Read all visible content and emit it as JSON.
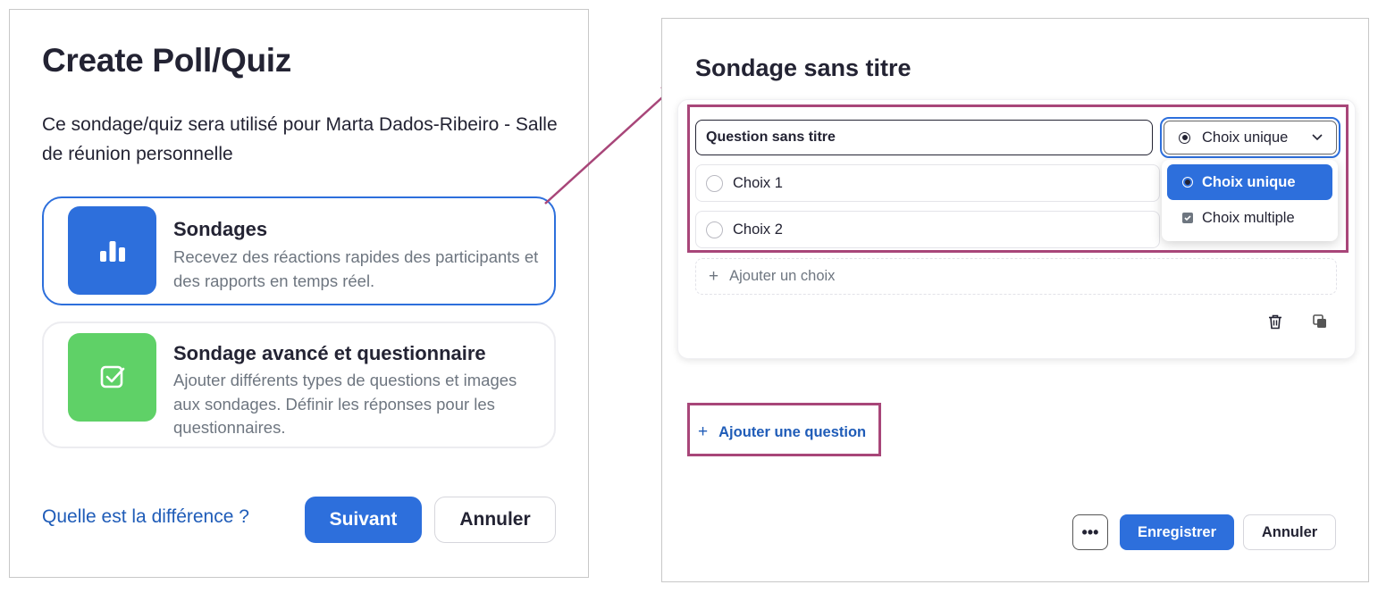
{
  "left": {
    "title": "Create Poll/Quiz",
    "description": "Ce sondage/quiz sera utilisé pour Marta Dados-Ribeiro - Salle de réunion personnelle",
    "options": [
      {
        "name": "Sondages",
        "text": "Recevez des réactions rapides des participants et des rapports en temps réel.",
        "icon": "bar-chart-icon",
        "color": "#2d6fdc",
        "selected": true
      },
      {
        "name": "Sondage avancé et questionnaire",
        "text": "Ajouter différents types de questions et images aux sondages. Définir les réponses pour les questionnaires.",
        "icon": "checkbox-icon",
        "color": "#5fd167",
        "selected": false
      }
    ],
    "diff_link": "Quelle est la différence ?",
    "next_label": "Suivant",
    "cancel_label": "Annuler"
  },
  "right": {
    "title": "Sondage sans titre",
    "question_value": "Question sans titre",
    "type_selected": "Choix unique",
    "type_options": [
      "Choix unique",
      "Choix multiple"
    ],
    "choices": [
      "Choix 1",
      "Choix 2"
    ],
    "add_choice": "Ajouter un choix",
    "add_question": "Ajouter une question",
    "more_label": "•••",
    "save_label": "Enregistrer",
    "cancel_label": "Annuler"
  },
  "colors": {
    "accent": "#2d6fdc",
    "green": "#5fd167",
    "highlight": "#a84679",
    "link": "#1f5cb8"
  }
}
